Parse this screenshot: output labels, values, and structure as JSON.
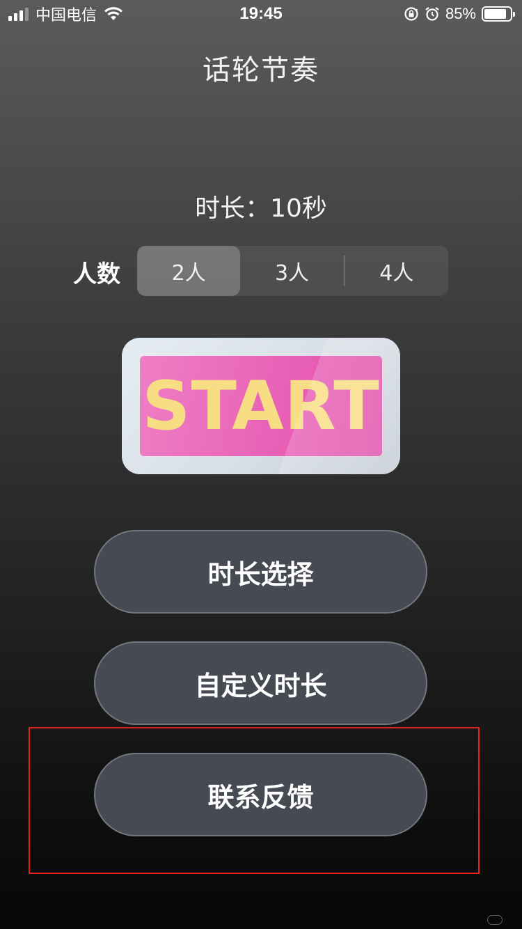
{
  "status_bar": {
    "carrier": "中国电信",
    "time": "19:45",
    "battery_percent": "85%",
    "battery_level": 0.85,
    "icons": [
      "signal-icon",
      "wifi-icon",
      "rotation-lock-icon",
      "alarm-icon",
      "battery-icon"
    ]
  },
  "app": {
    "title": "话轮节奏"
  },
  "duration": {
    "text": "时长：10秒"
  },
  "players": {
    "label": "人数",
    "options": [
      "2人",
      "3人",
      "4人"
    ],
    "selected": "2人"
  },
  "start_button": {
    "label": "START",
    "colors": {
      "frame": "#dce3e9",
      "face": "#e963b7",
      "text": "#f7dd83"
    }
  },
  "buttons": {
    "duration_select": "时长选择",
    "custom_duration": "自定义时长",
    "feedback": "联系反馈"
  },
  "colors": {
    "pill_bg": "#464a52",
    "highlight": "#e0241b"
  }
}
